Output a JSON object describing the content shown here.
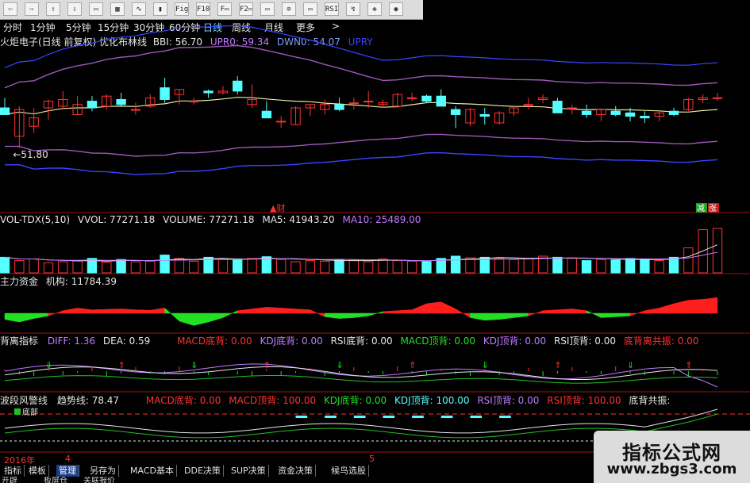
{
  "toolbar": {
    "buttons": [
      "⇦",
      "⇨",
      "⇧",
      "⇩",
      "▭",
      "▦",
      "∿",
      "▮",
      "Fig",
      "F10",
      "F▭",
      "F2▭",
      "▭",
      "⊙",
      "▭",
      "RSI",
      "↯",
      "✥",
      "◉"
    ]
  },
  "periods": [
    "分时",
    "1分钟",
    "5分钟",
    "15分钟",
    "30分钟",
    "60分钟",
    "日线",
    "周线",
    "月线",
    "更多",
    ">"
  ],
  "main_panel": {
    "title": "火炬电子(日线 前复权) 优化布林线",
    "bbi": "BBI: 56.70",
    "upr": "UPR0: 59.34",
    "dwn": "DWN0: 54.07",
    "upr_label": "UPRY",
    "low_label": "51.80",
    "cai_label": "财",
    "jian_label": "减",
    "zhang_label": "涨"
  },
  "vol_panel": {
    "name": "VOL-TDX(5,10)",
    "vvol": "VVOL: 77271.18",
    "volume": "VOLUME: 77271.18",
    "ma5": "MA5: 41943.20",
    "ma10": "MA10: 25489.00"
  },
  "fund_panel": {
    "name": "主力资金",
    "jigou": "机构: 11784.39"
  },
  "div_panel": {
    "name": "背离指标",
    "diff": "DIFF: 1.36",
    "dea": "DEA: 0.59",
    "items": [
      "MACD底背: 0.00",
      "KDJ底背: 0.00",
      "RSI底背: 0.00",
      "MACD顶背: 0.00",
      "KDJ顶背: 0.00",
      "RSI顶背: 0.00",
      "底背离共振: 0.00"
    ]
  },
  "wave_panel": {
    "name": "波段风警线",
    "trend": "趋势线: 78.47",
    "items": [
      "MACD底背: 0.00",
      "MACD顶背: 100.00",
      "KDJ底背: 0.00",
      "KDJ顶背: 100.00",
      "RSI顶背: 0.00",
      "RSI顶背: 100.00",
      "底背共振:"
    ],
    "label_low": "底部"
  },
  "footer": {
    "year": "2016年",
    "m4": "4",
    "m5": "5"
  },
  "tabs": [
    "指标",
    "模板",
    "管理",
    "另存为",
    "MACD基本",
    "DDE决策",
    "SUP决策",
    "资金决策",
    "候鸟选股"
  ],
  "tabs2": [
    "开辟",
    "板屏仓",
    "关联报价"
  ],
  "watermark": {
    "title": "指标公式网",
    "url": "www.zbgs3.com"
  },
  "colors": {
    "up": "#ff3232",
    "down": "#54ffff",
    "bbi": "#e8e8a0",
    "upper_band": "#9b59b6",
    "lower_band": "#3b44ff",
    "fund_up": "#ff1e1e",
    "fund_down": "#22e022",
    "separator": "#a01010"
  },
  "chart_data": {
    "type": "candlestick",
    "price": [
      {
        "o": 56.4,
        "h": 57.0,
        "l": 56.0,
        "c": 56.0
      },
      {
        "o": 54.7,
        "h": 56.5,
        "l": 54.0,
        "c": 56.3
      },
      {
        "o": 55.3,
        "h": 56.4,
        "l": 54.9,
        "c": 55.8
      },
      {
        "o": 56.4,
        "h": 56.9,
        "l": 55.7,
        "c": 56.8
      },
      {
        "o": 56.5,
        "h": 57.4,
        "l": 56.3,
        "c": 56.9
      },
      {
        "o": 56.0,
        "h": 57.1,
        "l": 56.0,
        "c": 56.6
      },
      {
        "o": 56.8,
        "h": 57.1,
        "l": 56.2,
        "c": 56.4
      },
      {
        "o": 56.5,
        "h": 57.2,
        "l": 56.3,
        "c": 57.1
      },
      {
        "o": 56.9,
        "h": 57.3,
        "l": 56.5,
        "c": 56.6
      },
      {
        "o": 56.3,
        "h": 56.7,
        "l": 56.0,
        "c": 56.3
      },
      {
        "o": 56.5,
        "h": 57.2,
        "l": 56.4,
        "c": 57.0
      },
      {
        "o": 57.6,
        "h": 58.2,
        "l": 56.7,
        "c": 56.9
      },
      {
        "o": 57.2,
        "h": 57.5,
        "l": 56.6,
        "c": 57.5
      },
      {
        "o": 56.8,
        "h": 57.0,
        "l": 56.6,
        "c": 56.8
      },
      {
        "o": 57.4,
        "h": 57.5,
        "l": 57.0,
        "c": 57.3
      },
      {
        "o": 57.3,
        "h": 57.7,
        "l": 57.2,
        "c": 57.4
      },
      {
        "o": 58.0,
        "h": 58.3,
        "l": 57.2,
        "c": 57.4
      },
      {
        "o": 56.6,
        "h": 57.8,
        "l": 56.4,
        "c": 56.9
      },
      {
        "o": 56.2,
        "h": 56.8,
        "l": 55.9,
        "c": 55.8
      },
      {
        "o": 55.6,
        "h": 55.9,
        "l": 55.2,
        "c": 55.6
      },
      {
        "o": 55.4,
        "h": 56.5,
        "l": 55.4,
        "c": 56.4
      },
      {
        "o": 56.4,
        "h": 56.6,
        "l": 55.9,
        "c": 56.6
      },
      {
        "o": 56.3,
        "h": 56.9,
        "l": 56.0,
        "c": 56.6
      },
      {
        "o": 56.6,
        "h": 57.0,
        "l": 56.2,
        "c": 56.3
      },
      {
        "o": 56.7,
        "h": 57.0,
        "l": 56.3,
        "c": 56.7
      },
      {
        "o": 56.8,
        "h": 57.4,
        "l": 56.4,
        "c": 56.8
      },
      {
        "o": 56.6,
        "h": 56.9,
        "l": 56.4,
        "c": 56.7
      },
      {
        "o": 56.5,
        "h": 57.3,
        "l": 56.4,
        "c": 57.2
      },
      {
        "o": 57.0,
        "h": 57.3,
        "l": 56.8,
        "c": 57.0
      },
      {
        "o": 57.1,
        "h": 57.2,
        "l": 56.7,
        "c": 56.8
      },
      {
        "o": 57.1,
        "h": 57.5,
        "l": 56.7,
        "c": 56.5
      },
      {
        "o": 56.3,
        "h": 56.5,
        "l": 55.2,
        "c": 56.0
      },
      {
        "o": 55.5,
        "h": 56.4,
        "l": 55.3,
        "c": 56.3
      },
      {
        "o": 56.0,
        "h": 56.4,
        "l": 55.4,
        "c": 55.9
      },
      {
        "o": 55.5,
        "h": 56.2,
        "l": 55.4,
        "c": 56.1
      },
      {
        "o": 56.1,
        "h": 56.5,
        "l": 55.9,
        "c": 56.4
      },
      {
        "o": 56.6,
        "h": 57.0,
        "l": 56.3,
        "c": 56.6
      },
      {
        "o": 56.9,
        "h": 57.2,
        "l": 56.7,
        "c": 57.0
      },
      {
        "o": 56.8,
        "h": 57.0,
        "l": 56.4,
        "c": 56.1
      },
      {
        "o": 56.4,
        "h": 56.6,
        "l": 56.0,
        "c": 56.4
      },
      {
        "o": 56.2,
        "h": 56.6,
        "l": 55.8,
        "c": 56.0
      },
      {
        "o": 56.0,
        "h": 56.3,
        "l": 55.6,
        "c": 56.3
      },
      {
        "o": 56.2,
        "h": 56.5,
        "l": 55.9,
        "c": 56.0
      },
      {
        "o": 56.1,
        "h": 56.4,
        "l": 55.6,
        "c": 55.9
      },
      {
        "o": 55.9,
        "h": 56.2,
        "l": 55.5,
        "c": 55.8
      },
      {
        "o": 55.9,
        "h": 56.2,
        "l": 55.6,
        "c": 56.1
      },
      {
        "o": 56.2,
        "h": 56.4,
        "l": 55.9,
        "c": 56.0
      },
      {
        "o": 56.3,
        "h": 57.0,
        "l": 56.2,
        "c": 56.9
      },
      {
        "o": 56.9,
        "h": 57.2,
        "l": 56.7,
        "c": 57.0
      },
      {
        "o": 57.0,
        "h": 57.3,
        "l": 56.8,
        "c": 57.0
      }
    ],
    "volume": [
      28,
      22,
      25,
      18,
      20,
      22,
      26,
      19,
      24,
      20,
      21,
      32,
      26,
      21,
      28,
      24,
      25,
      26,
      29,
      24,
      20,
      22,
      21,
      24,
      23,
      20,
      25,
      22,
      21,
      20,
      26,
      30,
      27,
      28,
      26,
      24,
      25,
      30,
      28,
      26,
      22,
      24,
      23,
      26,
      24,
      22,
      28,
      45,
      78,
      80
    ],
    "fund": [
      -14,
      -20,
      -12,
      -6,
      6,
      12,
      8,
      9,
      10,
      8,
      7,
      12,
      -18,
      -28,
      -20,
      -10,
      6,
      10,
      14,
      12,
      10,
      8,
      -8,
      -12,
      -10,
      -6,
      4,
      6,
      8,
      22,
      26,
      10,
      -10,
      -16,
      -14,
      -10,
      -6,
      6,
      8,
      10,
      6,
      -10,
      -8,
      -6,
      6,
      12,
      22,
      30,
      32,
      36
    ],
    "ylim": [
      51.0,
      60.0
    ]
  }
}
